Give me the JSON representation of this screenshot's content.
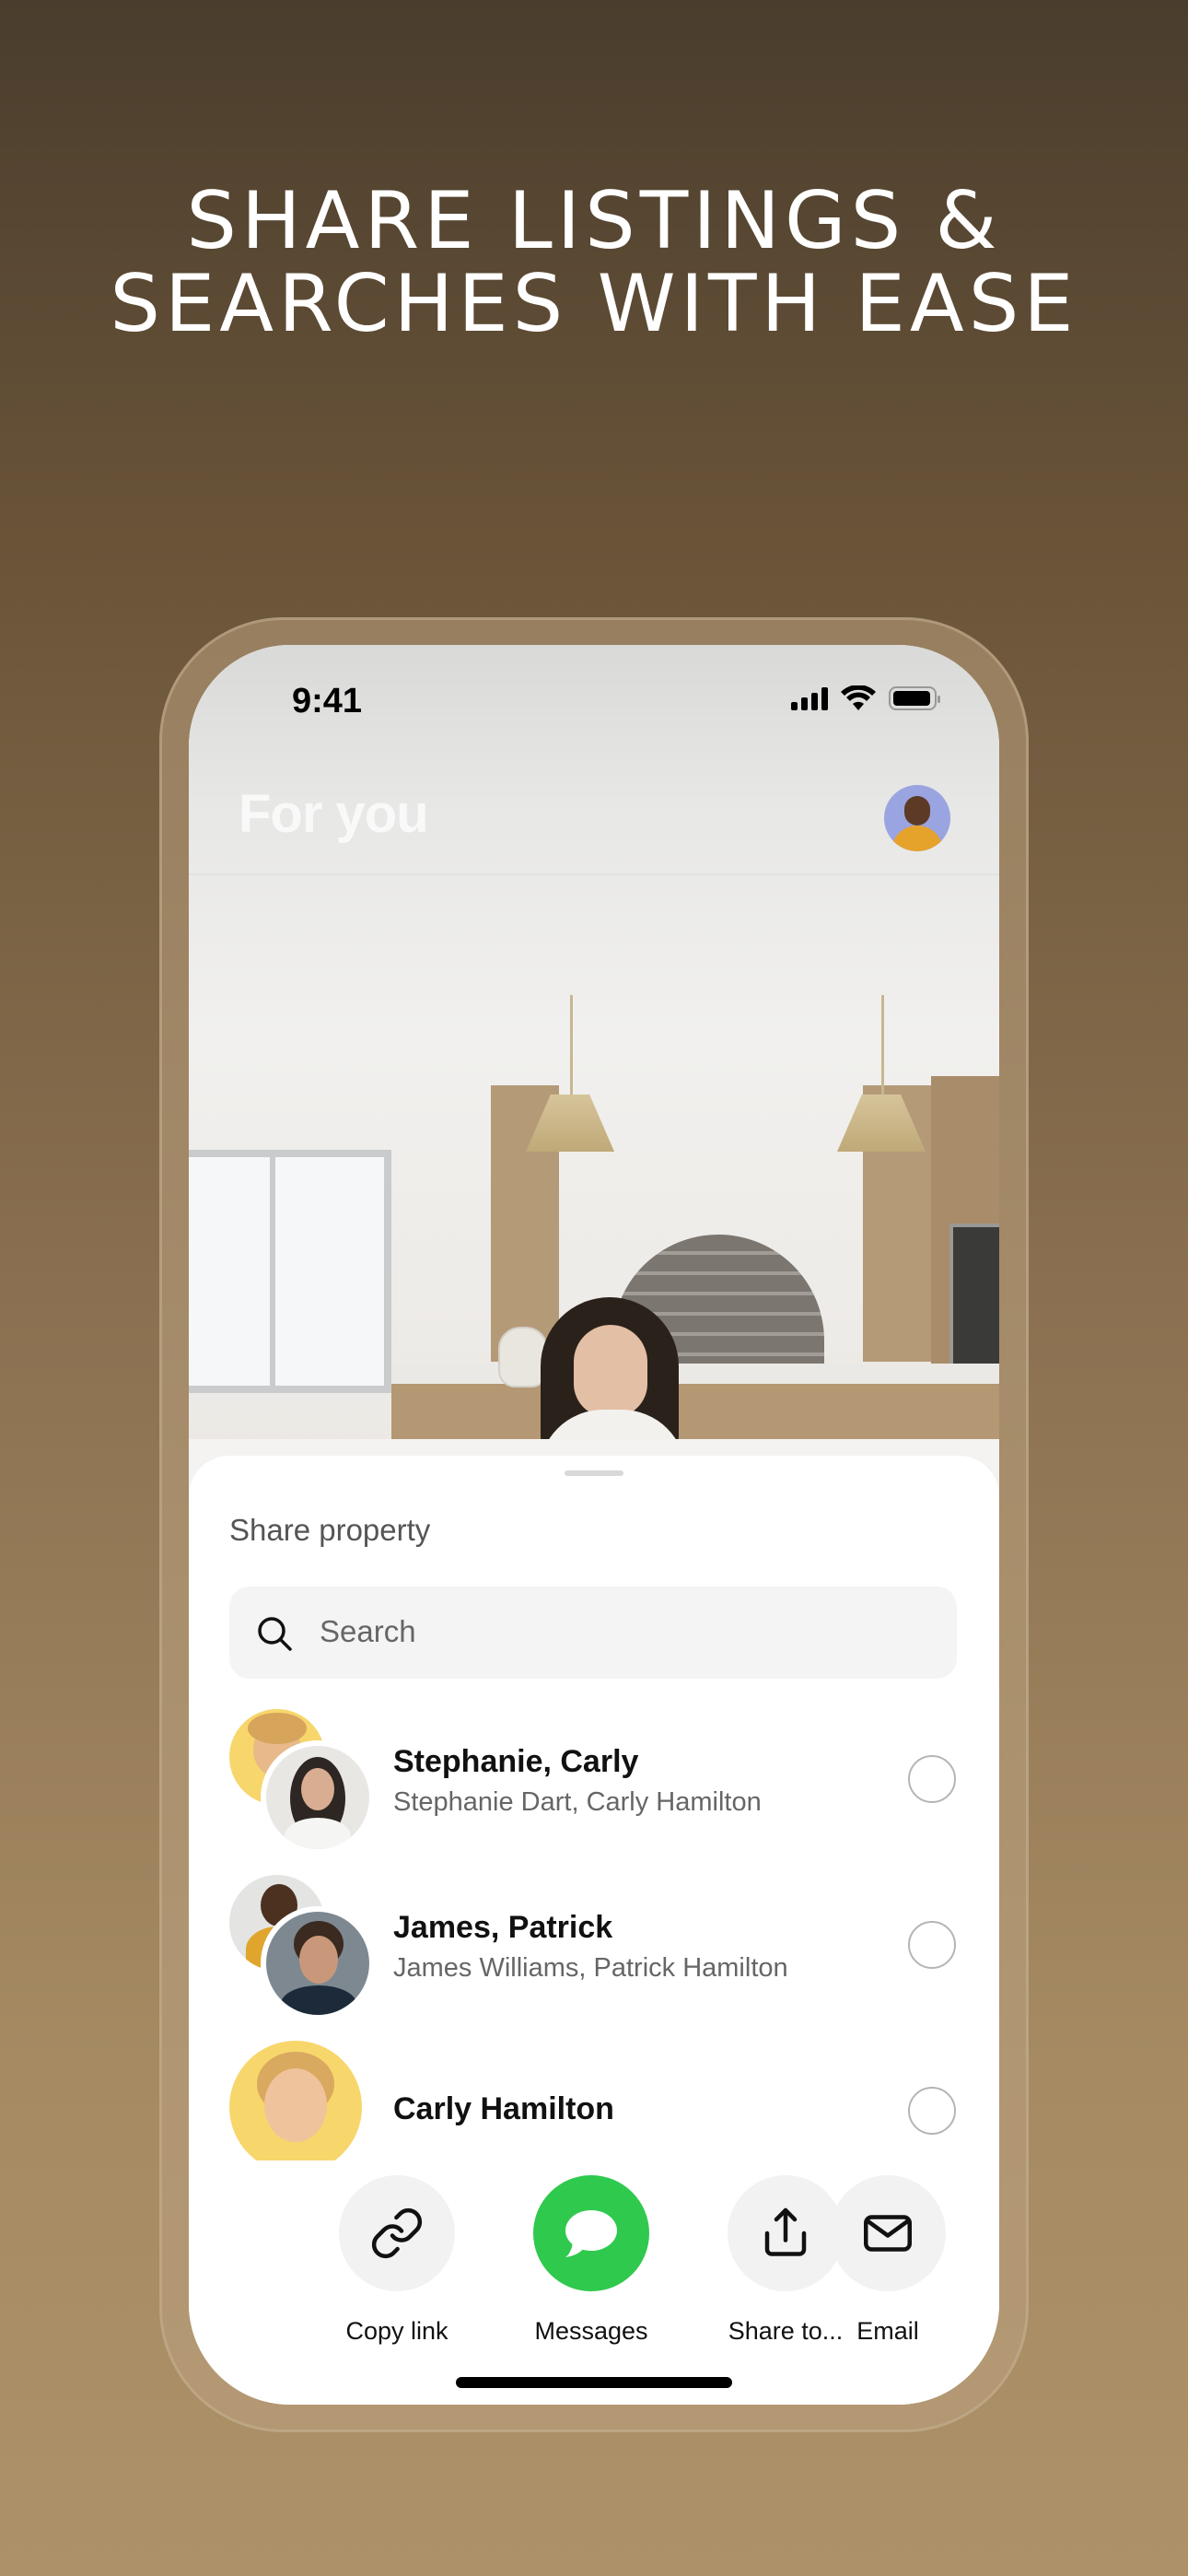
{
  "headline": {
    "line1": "SHARE LISTINGS &",
    "line2": "SEARCHES WITH EASE"
  },
  "status_bar": {
    "time": "9:41",
    "icons": [
      "cellular-signal-icon",
      "wifi-icon",
      "battery-icon"
    ]
  },
  "header": {
    "title": "For you",
    "avatar_icon": "profile-avatar"
  },
  "sheet": {
    "title": "Share property",
    "search": {
      "placeholder": "Search",
      "icon": "search-icon"
    },
    "contacts": [
      {
        "name": "Stephanie, Carly",
        "members": "Stephanie Dart, Carly Hamilton",
        "selected": false
      },
      {
        "name": "James, Patrick",
        "members": "James Williams, Patrick Hamilton",
        "selected": false
      },
      {
        "name": "Carly Hamilton",
        "members": "",
        "selected": false
      }
    ],
    "actions": [
      {
        "label": "Copy link",
        "icon": "link-icon"
      },
      {
        "label": "Messages",
        "icon": "message-bubble-icon",
        "color": "#2fc94e"
      },
      {
        "label": "Share to...",
        "icon": "share-icon"
      },
      {
        "label": "Email",
        "icon": "envelope-icon"
      }
    ]
  }
}
